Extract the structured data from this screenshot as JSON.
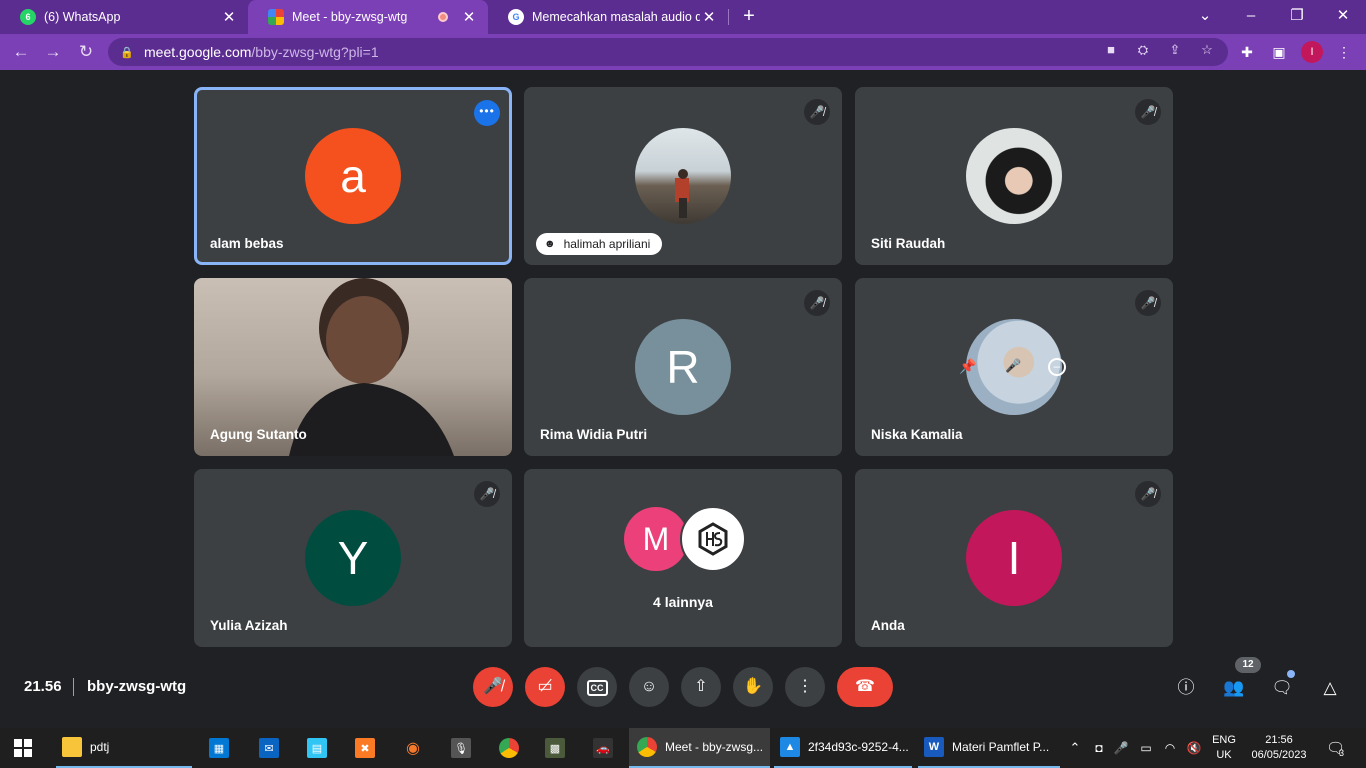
{
  "tabs": [
    {
      "title": "(6) WhatsApp",
      "badge": "6",
      "active": false
    },
    {
      "title": "Meet - bby-zwsg-wtg",
      "active": true
    },
    {
      "title": "Memecahkan masalah audio di G",
      "active": false
    }
  ],
  "address": {
    "host": "meet.google.com",
    "path": "/bby-zwsg-wtg?pli=1"
  },
  "browser_profile_initial": "I",
  "participants": [
    {
      "name": "alam bebas",
      "initial": "a",
      "color": "#f4511e",
      "muted": false,
      "active": true
    },
    {
      "name": "halimah apriliani",
      "photo": true,
      "muted": true
    },
    {
      "name": "Siti Raudah",
      "photo": true,
      "muted": true
    },
    {
      "name": "Agung Sutanto",
      "video": true,
      "muted": false
    },
    {
      "name": "Rima Widia Putri",
      "initial": "R",
      "color": "#78909c",
      "muted": true
    },
    {
      "name": "Niska Kamalia",
      "photo": true,
      "muted": true
    },
    {
      "name": "Yulia Azizah",
      "initial": "Y",
      "color": "#004d40",
      "muted": true
    },
    {
      "name": "4 lainnya",
      "initial": "M",
      "color": "#ec407a",
      "second_logo": "HS"
    },
    {
      "name": "Anda",
      "initial": "I",
      "color": "#c2185b",
      "muted": true
    }
  ],
  "meeting": {
    "time": "21.56",
    "code": "bby-zwsg-wtg",
    "participant_count": "12"
  },
  "taskbar": {
    "items": [
      {
        "label": "pdtj"
      },
      {
        "label": "Meet - bby-zwsg..."
      },
      {
        "label": "2f34d93c-9252-4..."
      },
      {
        "label": "Materi Pamflet P..."
      }
    ],
    "lang_top": "ENG",
    "lang_bottom": "UK",
    "clock_time": "21:56",
    "clock_date": "06/05/2023",
    "notification_count": "3"
  }
}
